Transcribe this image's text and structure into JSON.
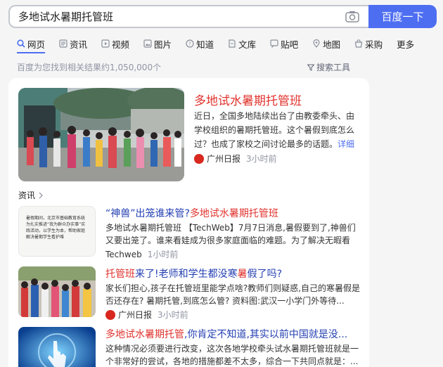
{
  "search": {
    "query": "多地试水暑期托管班",
    "button_label": "百度一下"
  },
  "tabs": [
    {
      "label": "网页",
      "icon": "search-icon"
    },
    {
      "label": "资讯",
      "icon": "news-icon"
    },
    {
      "label": "视频",
      "icon": "video-icon"
    },
    {
      "label": "图片",
      "icon": "image-icon"
    },
    {
      "label": "知道",
      "icon": "question-icon"
    },
    {
      "label": "文库",
      "icon": "document-icon"
    },
    {
      "label": "贴吧",
      "icon": "forum-icon"
    },
    {
      "label": "地图",
      "icon": "map-pin-icon"
    },
    {
      "label": "采购",
      "icon": "shop-icon"
    },
    {
      "label": "更多",
      "icon": ""
    }
  ],
  "results_meta": {
    "count_text": "百度为您找到相关结果约1,050,000个",
    "tools_label": "搜索工具"
  },
  "featured": {
    "title": "多地试水暑期托管班",
    "desc": "近日，全国多地陆续出台了由教委牵头、由学校组织的暑期托管班。这个暑假到底怎么过？也成了家校之间讨论最多的话题。",
    "more_label": "详细 >",
    "source": "广州日报",
    "time": "3小时前"
  },
  "section": {
    "label": "资讯"
  },
  "news": [
    {
      "title_parts": [
        "“神兽”出笼谁来管?",
        "多地试水暑期托管班"
      ],
      "desc": "多地试水暑期托管班 【TechWeb】7月7日消息,暑假要到了,神兽们又要出笼了。谁来看娃成为很多家庭面临的难题。为了解决无暇看娃...",
      "source": "Techweb",
      "time": "1小时前",
      "thumb_text": "暑假期间，北京市基础教育系统为扎实推进“我为群众办实事”实践活动，以学生为本，帮助家庭解决暑期学生看护难"
    },
    {
      "title_parts": [
        "托管班",
        "来了!老师和学生都没寒",
        "暑",
        "假了吗?"
      ],
      "desc": "家长们担心,孩子在托管班里能学点啥?教师们则疑惑,自己的寒暑假是否还存在? 暑期托管,到底怎么管? 资料图:武汉一小学门外等待...",
      "source": "广州日报",
      "time": "3小时前"
    },
    {
      "title_parts": [
        "多地试水暑期托管",
        ",你肯定不知道,其实以前中国就是没..."
      ],
      "desc": "这种情况必须要进行改变，这次各地学校牵头试水暑期托管班就是一个非常好的尝试，各地的措施都差不太多，综合一下共同点就是：...",
      "source": "",
      "time": ""
    }
  ],
  "colors": {
    "brand_blue": "#4e6ef2",
    "highlight_red": "#e1332e",
    "link_blue": "#2440b3",
    "muted_gray": "#9195a3"
  }
}
